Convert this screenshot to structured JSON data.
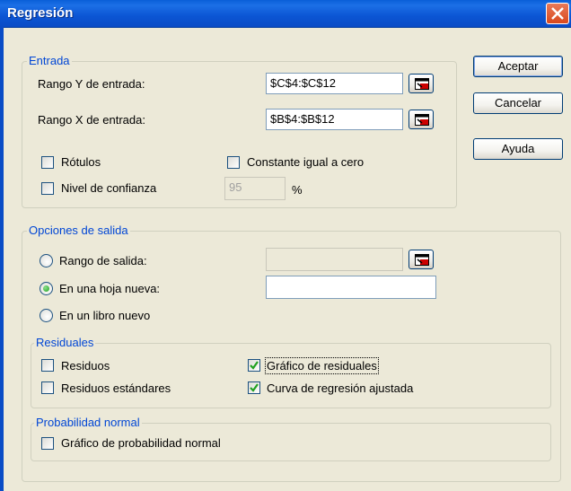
{
  "window": {
    "title": "Regresión"
  },
  "buttons": {
    "ok": "Aceptar",
    "cancel": "Cancelar",
    "help": "Ayuda"
  },
  "input_group": {
    "title": "Entrada",
    "y_range_label": "Rango Y de entrada:",
    "y_range_value": "$C$4:$C$12",
    "x_range_label": "Rango X de entrada:",
    "x_range_value": "$B$4:$B$12",
    "labels_label": "Rótulos",
    "labels_checked": false,
    "constant_zero_label": "Constante igual a cero",
    "constant_zero_checked": false,
    "confidence_label": "Nivel de confianza",
    "confidence_checked": false,
    "confidence_value": "95",
    "confidence_unit": "%"
  },
  "output_group": {
    "title": "Opciones de salida",
    "output_range_label": "Rango de salida:",
    "output_range_value": "",
    "new_sheet_label": "En una hoja nueva:",
    "new_sheet_value": "",
    "new_book_label": "En un libro nuevo",
    "selected_option": "new_sheet"
  },
  "residuals_group": {
    "title": "Residuales",
    "residuals_label": "Residuos",
    "residuals_checked": false,
    "std_residuals_label": "Residuos estándares",
    "std_residuals_checked": false,
    "residual_plots_label": "Gráfico de residuales",
    "residual_plots_checked": true,
    "line_fit_label": "Curva de regresión ajustada",
    "line_fit_checked": true
  },
  "normal_prob_group": {
    "title": "Probabilidad normal",
    "normal_plot_label": "Gráfico de probabilidad normal",
    "normal_plot_checked": false
  },
  "colors": {
    "titlebar": "#0a4cc6",
    "group_title": "#0046d5",
    "check": "#21a121"
  }
}
